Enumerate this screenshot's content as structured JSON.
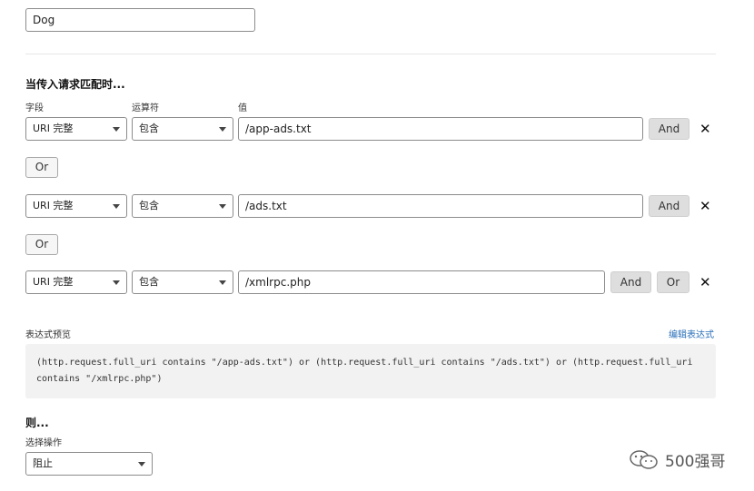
{
  "name_field": {
    "value": "Dog"
  },
  "when_heading": "当传入请求匹配时...",
  "columns": {
    "field": "字段",
    "operator": "运算符",
    "value": "值"
  },
  "rules": [
    {
      "field": "URI 完整",
      "operator": "包含",
      "value": "/app-ads.txt",
      "and_label": "And"
    },
    {
      "field": "URI 完整",
      "operator": "包含",
      "value": "/ads.txt",
      "and_label": "And"
    },
    {
      "field": "URI 完整",
      "operator": "包含",
      "value": "/xmlrpc.php",
      "and_label": "And",
      "or_label": "Or"
    }
  ],
  "or_buttons": [
    "Or",
    "Or"
  ],
  "preview": {
    "label": "表达式预览",
    "edit_link": "编辑表达式",
    "line1": "(http.request.full_uri contains \"/app-ads.txt\") or (http.request.full_uri contains \"/ads.txt\") or (http.request.full_uri",
    "line2": "contains \"/xmlrpc.php\")"
  },
  "then": {
    "heading": "则...",
    "action_label": "选择操作",
    "action_value": "阻止"
  },
  "watermark": {
    "text": "500强哥",
    "icon": "wechat-icon"
  }
}
